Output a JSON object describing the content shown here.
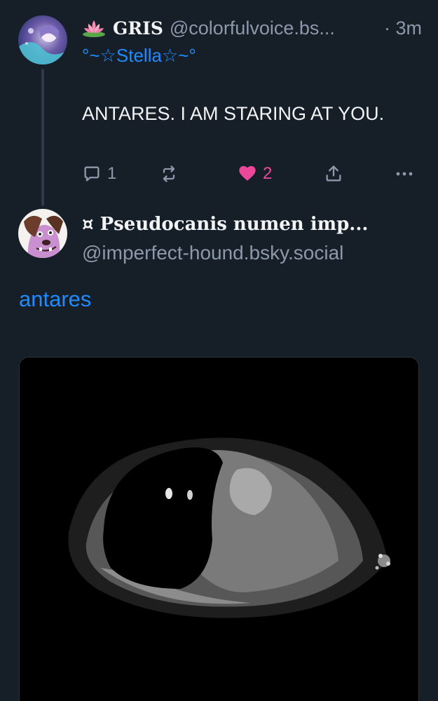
{
  "parent_post": {
    "emoji": "lotus-icon",
    "display_name": "GRIS",
    "handle": "@colorfulvoice.bs...",
    "time": "· 3m",
    "reply_name": "°~☆Stella☆~°",
    "text": "ANTARES. I AM STARING AT YOU.",
    "actions": {
      "reply_count": "1",
      "like_count": "2",
      "like_color": "#ec4899"
    }
  },
  "main_post": {
    "display_name": "¤ Pseudocanis numen imp...",
    "handle": "@imperfect-hound.bsky.social",
    "text": "antares",
    "image_alt": "pixelated eye"
  },
  "colors": {
    "background": "#161e27",
    "link": "#208bfe",
    "muted": "#8d99ab",
    "text": "#f1f3f5"
  }
}
